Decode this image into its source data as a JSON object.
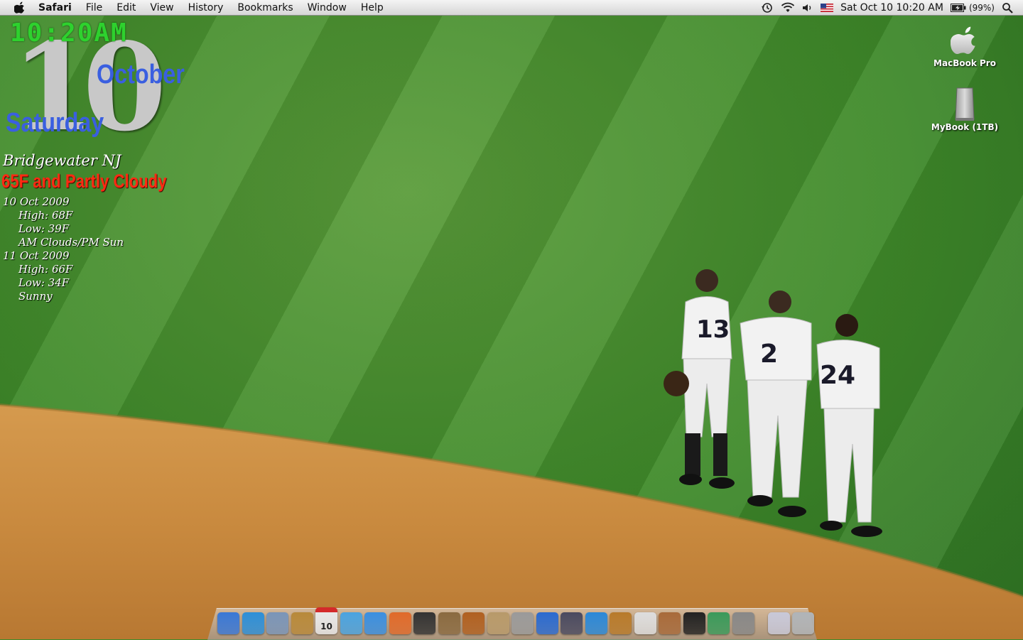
{
  "menubar": {
    "app_name": "Safari",
    "menus": [
      "File",
      "Edit",
      "View",
      "History",
      "Bookmarks",
      "Window",
      "Help"
    ],
    "clock": "Sat Oct 10  10:20 AM",
    "battery": "(99%)"
  },
  "datetime_widget": {
    "time": "10:20AM",
    "day": "10",
    "month": "October",
    "weekday": "Saturday"
  },
  "weather_widget": {
    "city": "Bridgewater NJ",
    "current": "65F and Partly Cloudy",
    "forecast": [
      {
        "date": "10 Oct 2009",
        "high": "High: 68F",
        "low": "Low: 39F",
        "cond": "AM Clouds/PM Sun"
      },
      {
        "date": "11 Oct 2009",
        "high": "High: 66F",
        "low": "Low: 34F",
        "cond": "Sunny"
      }
    ]
  },
  "desktop_icons": {
    "macbook": "MacBook Pro",
    "mybook": "MyBook (1TB)"
  },
  "players": {
    "numbers": [
      "13",
      "2",
      "24"
    ]
  },
  "dock": {
    "calendar_day": "10",
    "items": [
      {
        "icon": "finder-icon",
        "color": "#3a78d6"
      },
      {
        "icon": "safari-icon",
        "color": "#2d8fd8"
      },
      {
        "icon": "mail-icon",
        "color": "#7a95b8"
      },
      {
        "icon": "address-book-icon",
        "color": "#b8893a"
      },
      {
        "icon": "ical-icon",
        "color": "#e8e8e8"
      },
      {
        "icon": "iweb-icon",
        "color": "#4aa3e0"
      },
      {
        "icon": "itunes-icon",
        "color": "#3a8fe0"
      },
      {
        "icon": "feather-app-icon",
        "color": "#e06a2a"
      },
      {
        "icon": "aperture-icon",
        "color": "#333333"
      },
      {
        "icon": "iphoto-icon",
        "color": "#8a6a40"
      },
      {
        "icon": "photo-booth-icon",
        "color": "#b06020"
      },
      {
        "icon": "preview-icon",
        "color": "#b89a6a"
      },
      {
        "icon": "imovie-icon",
        "color": "#9a9a9a"
      },
      {
        "icon": "dvd-player-icon",
        "color": "#2a6ad0"
      },
      {
        "icon": "notebook-icon",
        "color": "#4a4a60"
      },
      {
        "icon": "app-store-icon",
        "color": "#2a88d8"
      },
      {
        "icon": "tropical-app-icon",
        "color": "#b87a2a"
      },
      {
        "icon": "utility-icon",
        "color": "#dddddd"
      },
      {
        "icon": "game-app-icon",
        "color": "#a86a3a"
      },
      {
        "icon": "blackberry-icon",
        "color": "#222222"
      },
      {
        "icon": "activity-app-icon",
        "color": "#3a9a5a"
      },
      {
        "icon": "system-preferences-icon",
        "color": "#888888"
      },
      {
        "icon": "documents-stack-icon",
        "color": "#c8c8d8"
      },
      {
        "icon": "trash-icon",
        "color": "#b0b4b8"
      }
    ]
  }
}
